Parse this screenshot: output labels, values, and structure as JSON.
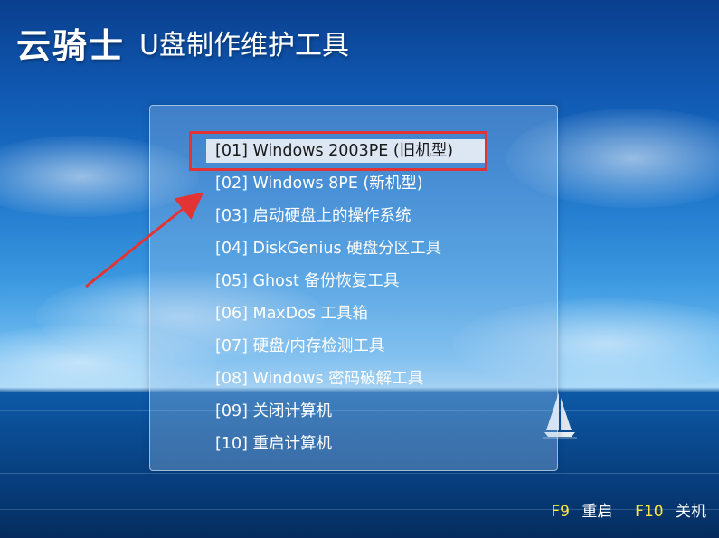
{
  "logo": {
    "brand": "云骑士",
    "subtitle": "U盘制作维护工具"
  },
  "menu": {
    "selected_index": 0,
    "items": [
      {
        "label": "[01] Windows 2003PE (旧机型)"
      },
      {
        "label": "[02] Windows 8PE (新机型)"
      },
      {
        "label": "[03] 启动硬盘上的操作系统"
      },
      {
        "label": "[04] DiskGenius 硬盘分区工具"
      },
      {
        "label": "[05] Ghost 备份恢复工具"
      },
      {
        "label": "[06] MaxDos 工具箱"
      },
      {
        "label": "[07] 硬盘/内存检测工具"
      },
      {
        "label": "[08] Windows 密码破解工具"
      },
      {
        "label": "[09] 关闭计算机"
      },
      {
        "label": "[10] 重启计算机"
      }
    ]
  },
  "footer": {
    "f9_key": "F9",
    "f9_action": "重启",
    "f10_key": "F10",
    "f10_action": "关机"
  },
  "colors": {
    "highlight_border": "#e23434",
    "selected_bg": "#dde7f3",
    "footer_key": "#ffe640",
    "arrow": "#e23434"
  },
  "icons": {
    "annotation_arrow": "arrow-icon",
    "background_boat": "sailboat-icon"
  }
}
